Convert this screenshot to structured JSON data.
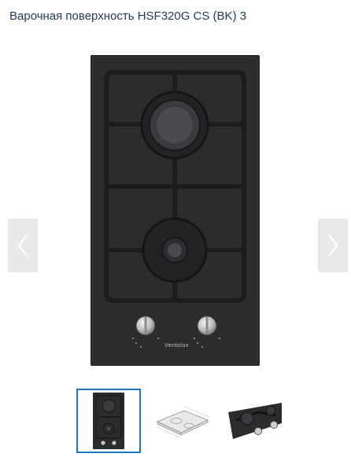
{
  "product": {
    "title": "Варочная поверхность HSF320G CS (BK) 3",
    "brand_mark": "Ventolux"
  },
  "gallery": {
    "thumbnails": [
      {
        "name": "front-view",
        "active": true
      },
      {
        "name": "dimensions-drawing",
        "active": false
      },
      {
        "name": "close-up-angle",
        "active": false
      }
    ],
    "colors": {
      "active_border": "#1f75c4",
      "arrow_bg": "#e9e9eb",
      "title": "#1f3a5f"
    }
  }
}
